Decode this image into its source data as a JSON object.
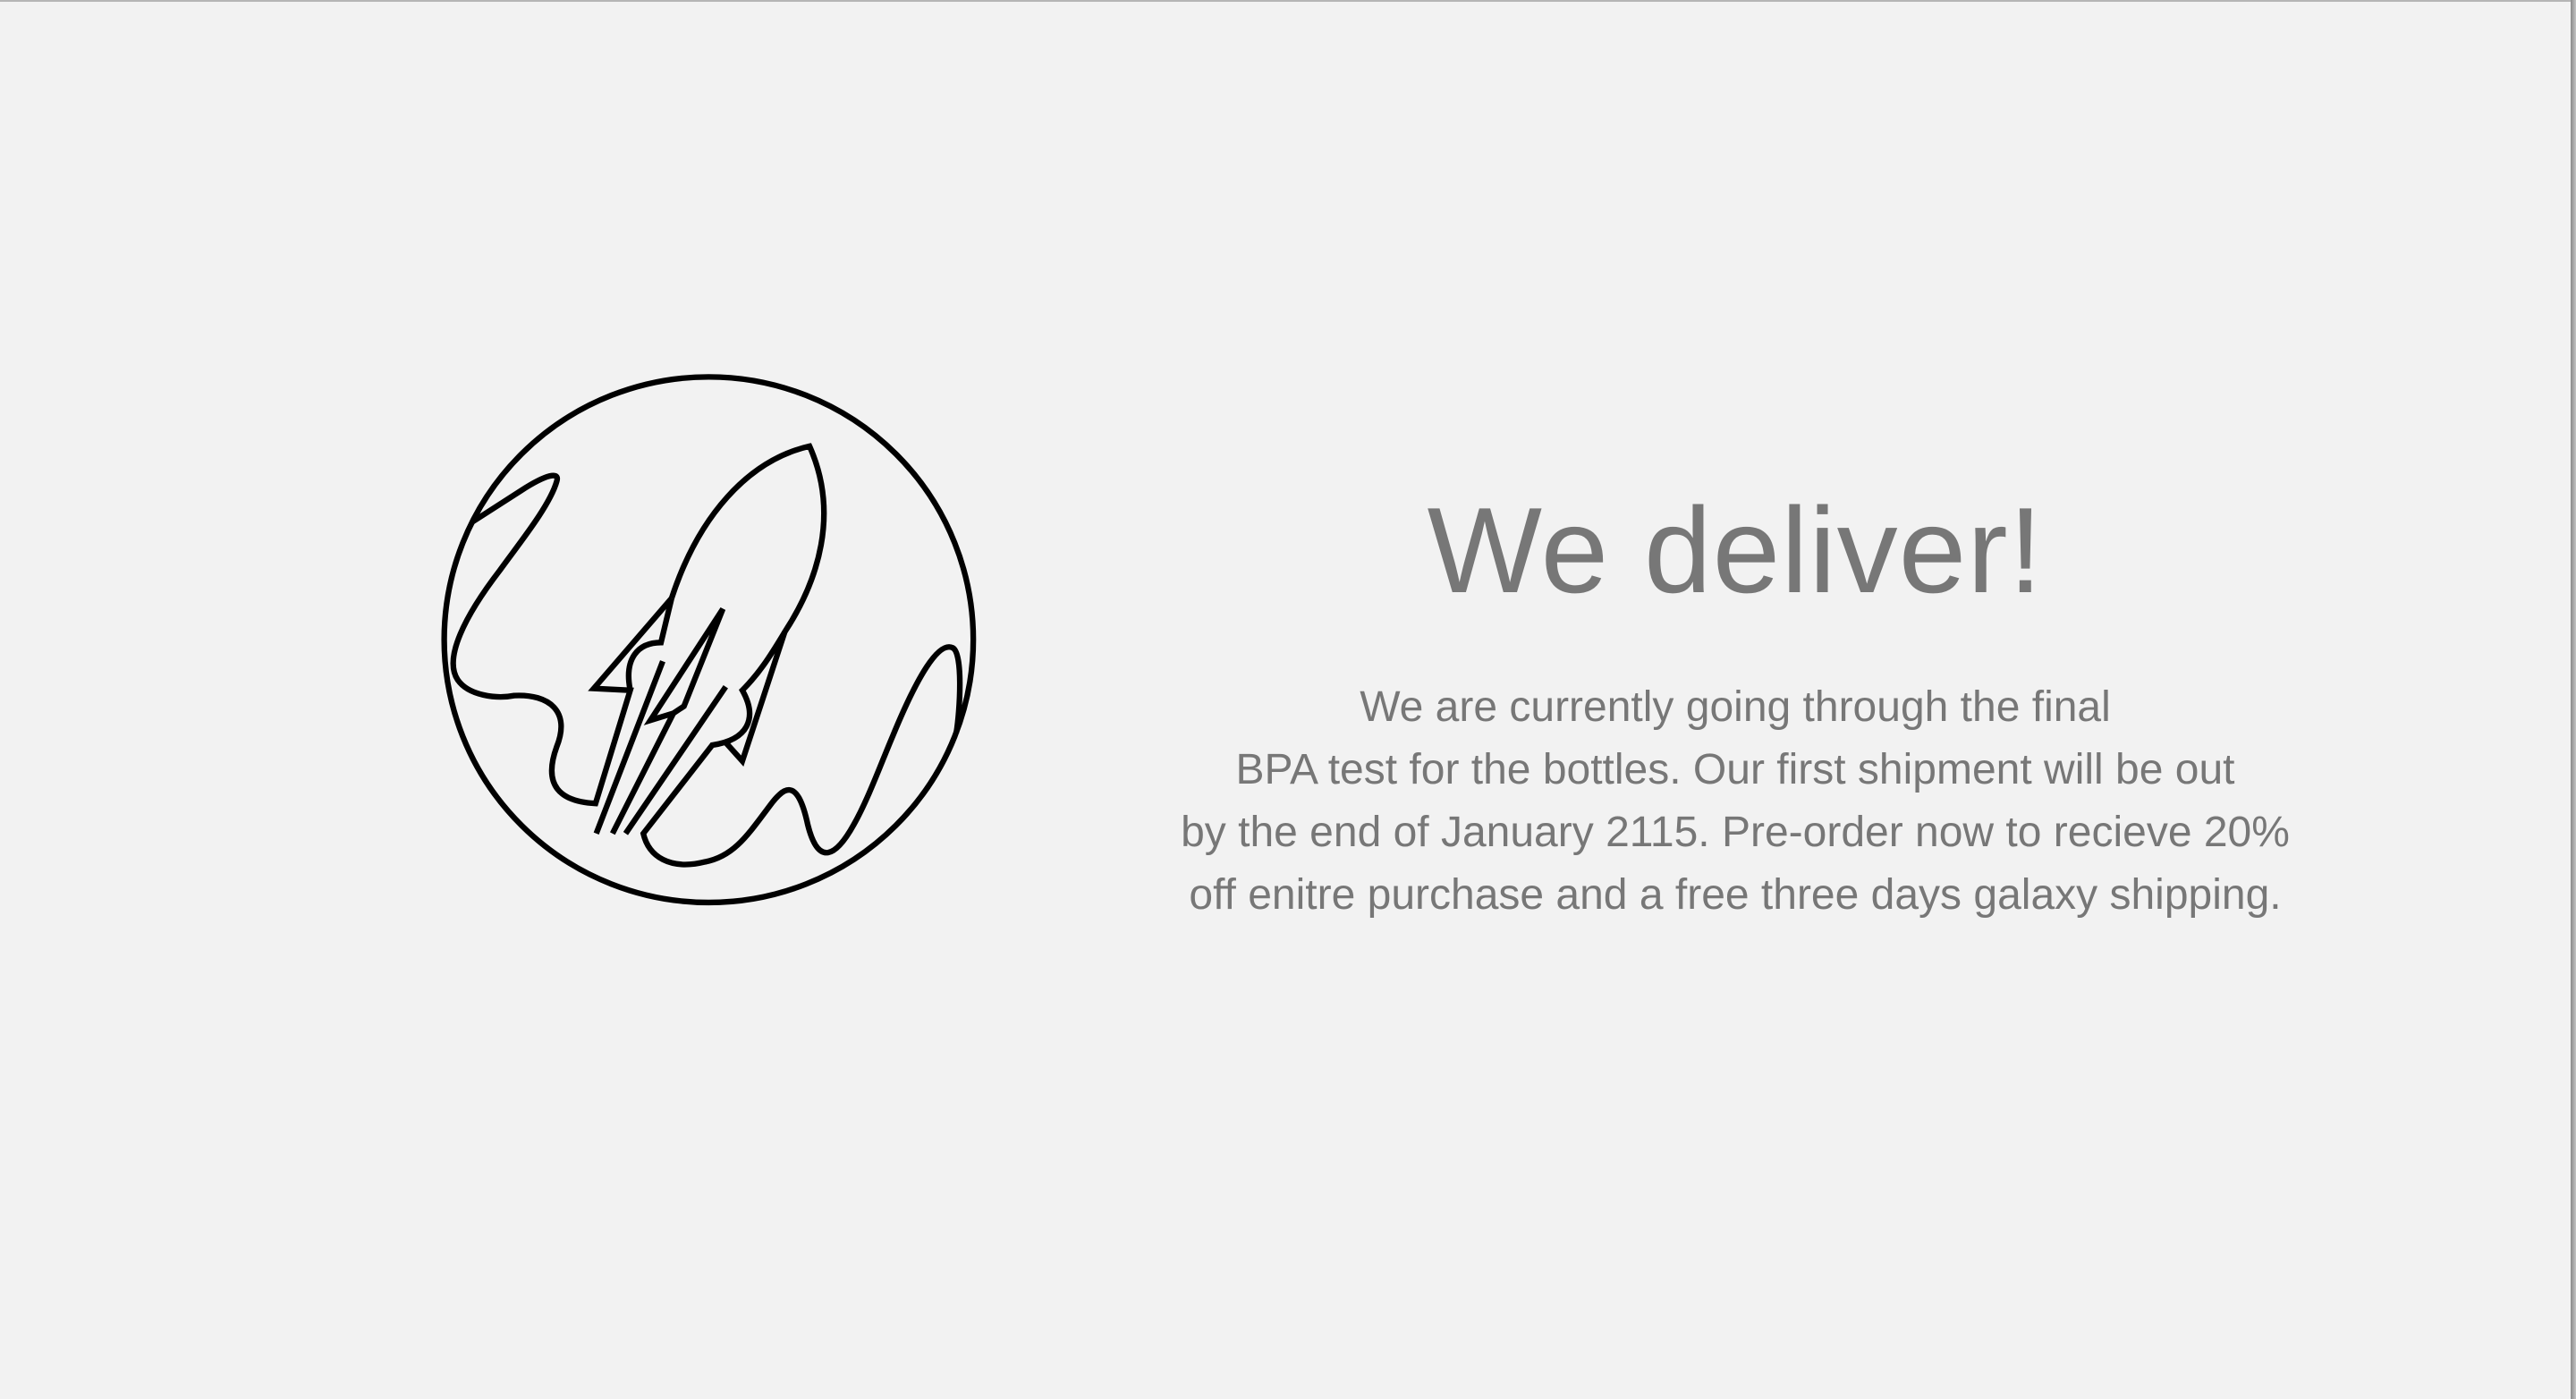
{
  "logo": {
    "icon": "rocket-planet-icon",
    "stroke_color": "#000000"
  },
  "main": {
    "heading": "We deliver!",
    "description": "We are currently going through the final\nBPA test for the bottles. Our first shipment will be out\nby the end of January 2115. Pre-order now to recieve 20%\noff enitre purchase and a free three days galaxy shipping."
  },
  "colors": {
    "background": "#f2f2f2",
    "text": "#777777"
  }
}
